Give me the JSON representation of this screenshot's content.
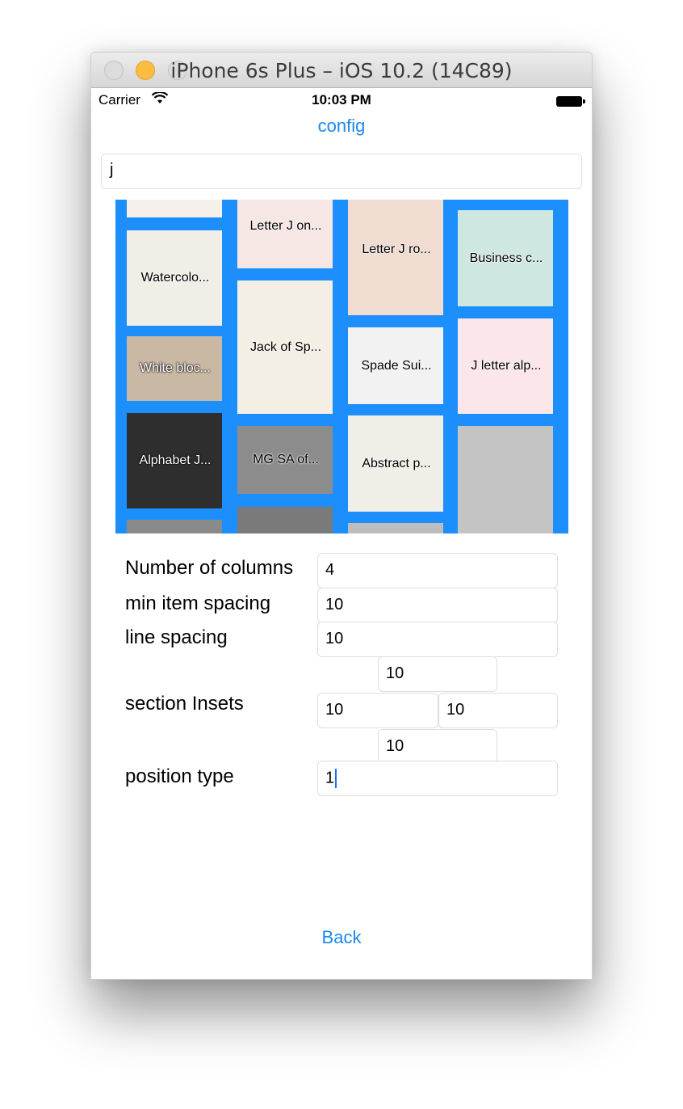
{
  "window": {
    "title": "iPhone 6s Plus – iOS 10.2 (14C89)"
  },
  "status_bar": {
    "carrier": "Carrier",
    "time": "10:03 PM"
  },
  "nav": {
    "title": "config"
  },
  "search": {
    "value": "j"
  },
  "grid": {
    "background": "#1d8ffd",
    "columns": [
      {
        "tiles": [
          {
            "label": "",
            "bg": "#f5f1ea"
          },
          {
            "label": "Watercolo...",
            "bg": "#f0eee6"
          },
          {
            "label": "White bloc...",
            "bg": "#c9b8a3",
            "light": true
          },
          {
            "label": "Alphabet J...",
            "bg": "#2e2e2e",
            "light": true
          },
          {
            "label": "",
            "bg": "#8a8a8a"
          }
        ]
      },
      {
        "tiles": [
          {
            "label": "Letter J on...",
            "bg": "#f6e6e4"
          },
          {
            "label": "Jack of Sp...",
            "bg": "#f4efe4"
          },
          {
            "label": "MG SA of...",
            "bg": "#8c8c8c"
          },
          {
            "label": "",
            "bg": "#7a7a7a"
          }
        ]
      },
      {
        "tiles": [
          {
            "label": "Letter J ro...",
            "bg": "#f0dcd0"
          },
          {
            "label": "Spade Sui...",
            "bg": "#f2f2f2"
          },
          {
            "label": "Abstract p...",
            "bg": "#f0eee6"
          },
          {
            "label": "",
            "bg": "#bdbdbd"
          }
        ]
      },
      {
        "tiles": [
          {
            "label": "Business c...",
            "bg": "#cfe7e1"
          },
          {
            "label": "J letter alp...",
            "bg": "#fbe6ea"
          },
          {
            "label": "",
            "bg": "#c4c4c4"
          }
        ]
      }
    ]
  },
  "form": {
    "columns_label": "Number of columns",
    "columns_value": "4",
    "min_item_spacing_label": "min item spacing",
    "min_item_spacing_value": "10",
    "line_spacing_label": "line spacing",
    "line_spacing_value": "10",
    "section_insets_label": "section Insets",
    "inset_top": "10",
    "inset_left": "10",
    "inset_right": "10",
    "inset_bottom": "10",
    "position_type_label": "position type",
    "position_type_value": "1"
  },
  "back_button": {
    "label": "Back"
  }
}
